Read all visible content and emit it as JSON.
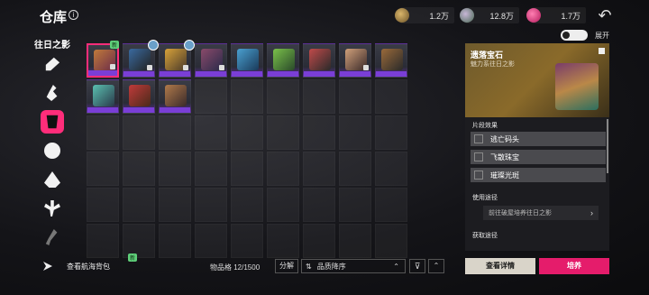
{
  "header": {
    "title": "仓库",
    "info_icon": "i",
    "currencies": [
      {
        "icon": "gold-coin-icon",
        "value": "1.2万"
      },
      {
        "icon": "green-coin-icon",
        "value": "12.8万"
      },
      {
        "icon": "pink-gem-icon",
        "value": "1.7万"
      }
    ],
    "back_icon": "↶"
  },
  "sidebar": {
    "title": "往日之影",
    "categories": [
      {
        "name": "category-1-icon"
      },
      {
        "name": "category-2-icon"
      },
      {
        "name": "category-3-icon",
        "active": true
      },
      {
        "name": "category-4-icon"
      },
      {
        "name": "category-5-icon"
      },
      {
        "name": "category-6-icon"
      },
      {
        "name": "category-7-icon"
      }
    ]
  },
  "grid": {
    "new_badge": "新",
    "items_filled": 12
  },
  "detail": {
    "toggle_label": "展开",
    "item_name": "遗落宝石",
    "item_subtitle": "魅力系往日之影",
    "effects_title": "片段效果",
    "effects": [
      "逃亡码头",
      "飞散珠宝",
      "璀璨光斑"
    ],
    "usage_title": "使用途径",
    "usage_route": "前往破屋培养往日之影",
    "usage_chevron": "›",
    "obtain_title": "获取途径",
    "btn_detail": "查看详情",
    "btn_train": "培养"
  },
  "bottom": {
    "sea_bag_label": "查看航海背包",
    "sea_bag_badge": "新",
    "capacity": "物品格 12/1500",
    "decompose": "分解",
    "sort_icon": "⇅",
    "sort_label": "品质降序",
    "sort_dir": "⌃",
    "filter_icon": "⊽",
    "collapse_icon": "⌃"
  },
  "colors": {
    "accent": "#e51c6b",
    "rarity_purple": "#7a3ed6"
  }
}
